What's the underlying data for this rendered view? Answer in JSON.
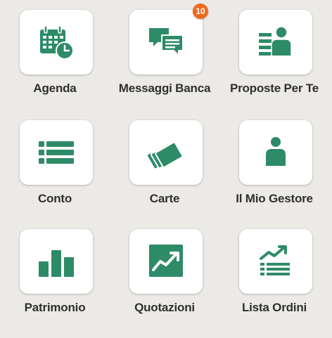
{
  "theme": {
    "accent": "#2E8B68",
    "badge": "#EE6A1B",
    "background": "#ECEAE7",
    "label": "#2F2F2F"
  },
  "menu": [
    {
      "label": "Agenda",
      "icon": "calendar-clock-icon"
    },
    {
      "label": "Messaggi Banca",
      "icon": "chat-bubbles-icon",
      "badge": "10"
    },
    {
      "label": "Proposte Per Te",
      "icon": "person-list-icon"
    },
    {
      "label": "Conto",
      "icon": "list-icon"
    },
    {
      "label": "Carte",
      "icon": "cards-icon"
    },
    {
      "label": "Il Mio Gestore",
      "icon": "person-icon"
    },
    {
      "label": "Patrimonio",
      "icon": "bar-chart-icon"
    },
    {
      "label": "Quotazioni",
      "icon": "trend-chart-icon"
    },
    {
      "label": "Lista Ordini",
      "icon": "order-list-icon"
    }
  ]
}
